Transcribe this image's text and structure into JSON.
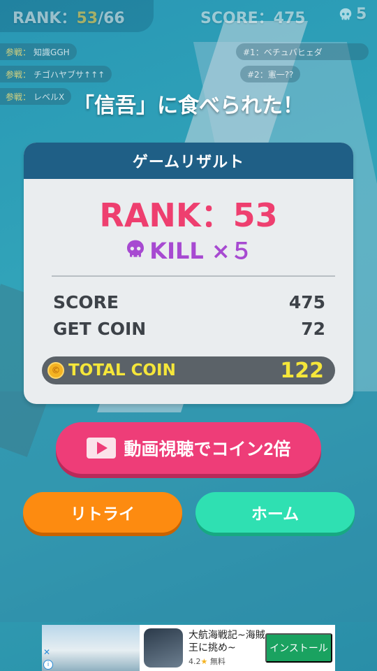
{
  "hud": {
    "rank_label": "RANK：",
    "rank_current": "53",
    "rank_total": "/66",
    "score_text": "SCORE：475",
    "kill_count": "5"
  },
  "kill_feed": [
    {
      "prefix": "参戦：",
      "name": "知識GGH"
    },
    {
      "prefix": "参戦：",
      "name": "チゴハヤブサ↑↑↑"
    },
    {
      "prefix": "参戦：",
      "name": "レベルX"
    }
  ],
  "leaderboard": [
    {
      "text": "#1：ベチュバヒェダ"
    },
    {
      "text": "#2：憲一??"
    }
  ],
  "eaten_message": "「信吾」に食べられた！",
  "result": {
    "header": "ゲームリザルト",
    "rank_text": "RANK：53",
    "kill_text": "KILL ×５",
    "stats": [
      {
        "label": "SCORE",
        "value": "475"
      },
      {
        "label": "GET COIN",
        "value": "72"
      }
    ],
    "total_label": "TOTAL COIN",
    "total_value": "122"
  },
  "buttons": {
    "video_label": "動画視聴でコイン2倍",
    "retry_label": "リトライ",
    "home_label": "ホーム"
  },
  "ad": {
    "title": "大航海戦記~海賊王に挑め~",
    "rating": "4.2",
    "rating_suffix": "無料",
    "install_label": "インストール"
  },
  "icons": {
    "skull": "skull-icon",
    "coin": "coin-icon",
    "play": "play-icon"
  },
  "colors": {
    "rank_pink": "#ee3f6f",
    "kill_purple": "#a74ad1",
    "header_blue": "#1f5f86",
    "video_button": "#ee3d78",
    "retry_button": "#fd8b10",
    "home_button": "#2fe0b2",
    "total_yellow": "#f5e63a"
  }
}
